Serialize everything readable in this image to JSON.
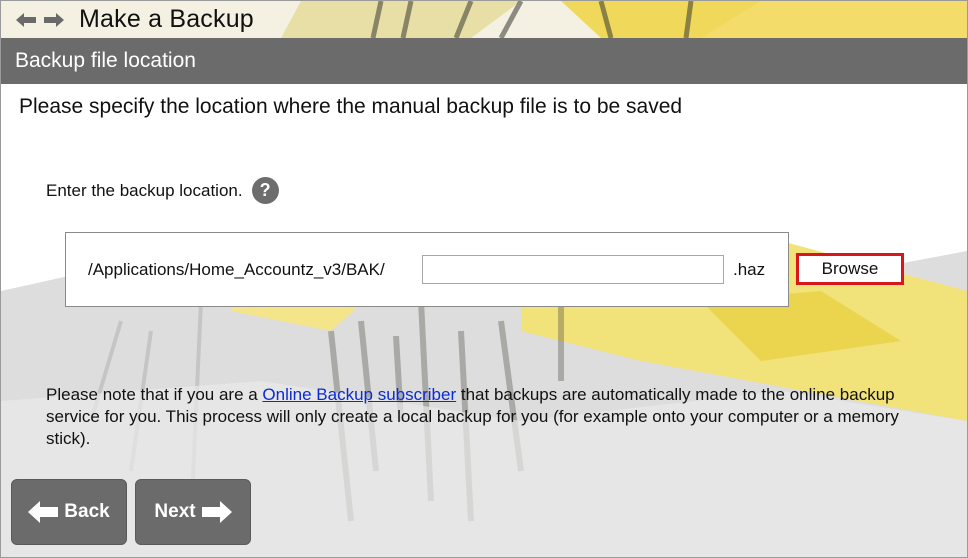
{
  "window": {
    "title": "Make a Backup",
    "nav_back_icon": "left-arrow-icon",
    "nav_forward_icon": "right-arrow-icon"
  },
  "section": {
    "title": "Backup file location"
  },
  "main": {
    "instruction": "Please specify the location where the manual backup file is to be saved",
    "enter_label": "Enter the backup location.",
    "help_glyph": "?",
    "path_prefix": "/Applications/Home_Accountz_v3/BAK/",
    "filename_value": "",
    "extension": ".haz",
    "browse_label": "Browse"
  },
  "note": {
    "before_link": "Please note that if you are a ",
    "link_text": "Online Backup subscriber",
    "after_link": " that backups are automatically made to the online backup service for you. This process will only create a local backup for you (for example onto your computer or a memory stick)."
  },
  "footer": {
    "back_label": "Back",
    "next_label": "Next"
  },
  "colors": {
    "section_bar": "#6b6b6b",
    "browse_highlight": "#d9161c",
    "link": "#0a2bd6",
    "accent_yellow": "#f2d21c"
  }
}
